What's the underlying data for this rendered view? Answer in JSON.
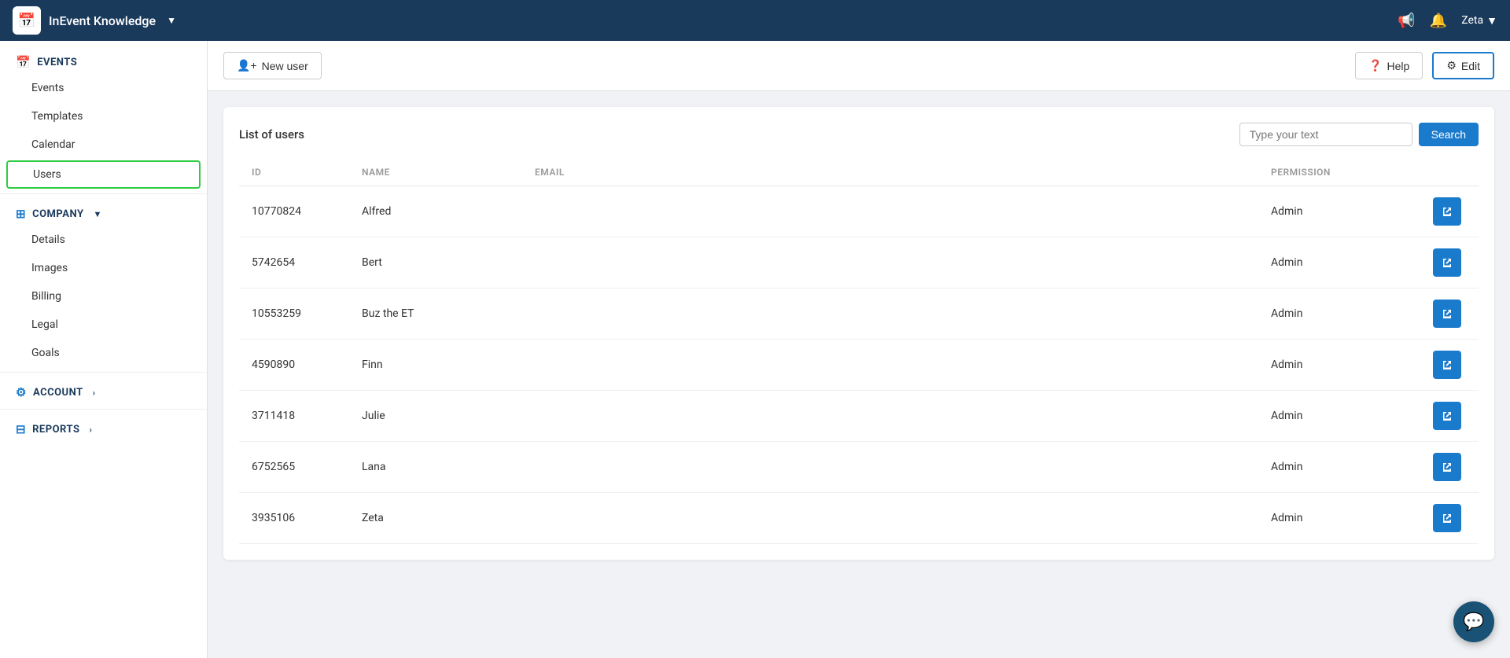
{
  "topnav": {
    "logo": "📅",
    "title": "InEvent Knowledge",
    "chevron": "▼",
    "user": "Zeta",
    "user_chevron": "▼"
  },
  "toolbar": {
    "new_user_label": "New user",
    "help_label": "Help",
    "edit_label": "Edit"
  },
  "sidebar": {
    "events_section": "EVENTS",
    "events_items": [
      "Events",
      "Templates",
      "Calendar",
      "Users"
    ],
    "company_section": "COMPANY",
    "company_items": [
      "Details",
      "Images",
      "Billing",
      "Legal",
      "Goals"
    ],
    "account_section": "ACCOUNT",
    "reports_section": "REPORTS",
    "active_item": "Users"
  },
  "card": {
    "title": "List of users",
    "search_placeholder": "Type your text",
    "search_button": "Search"
  },
  "table": {
    "headers": [
      "ID",
      "NAME",
      "EMAIL",
      "PERMISSION"
    ],
    "rows": [
      {
        "id": "10770824",
        "name": "Alfred",
        "email": "",
        "permission": "Admin"
      },
      {
        "id": "5742654",
        "name": "Bert",
        "email": "",
        "permission": "Admin"
      },
      {
        "id": "10553259",
        "name": "Buz the ET",
        "email": "",
        "permission": "Admin"
      },
      {
        "id": "4590890",
        "name": "Finn",
        "email": "",
        "permission": "Admin"
      },
      {
        "id": "3711418",
        "name": "Julie",
        "email": "",
        "permission": "Admin"
      },
      {
        "id": "6752565",
        "name": "Lana",
        "email": "",
        "permission": "Admin"
      },
      {
        "id": "3935106",
        "name": "Zeta",
        "email": "",
        "permission": "Admin"
      }
    ]
  },
  "colors": {
    "topnav_bg": "#1a3a5c",
    "accent": "#1a7acc",
    "active_border": "#2ecc40"
  }
}
